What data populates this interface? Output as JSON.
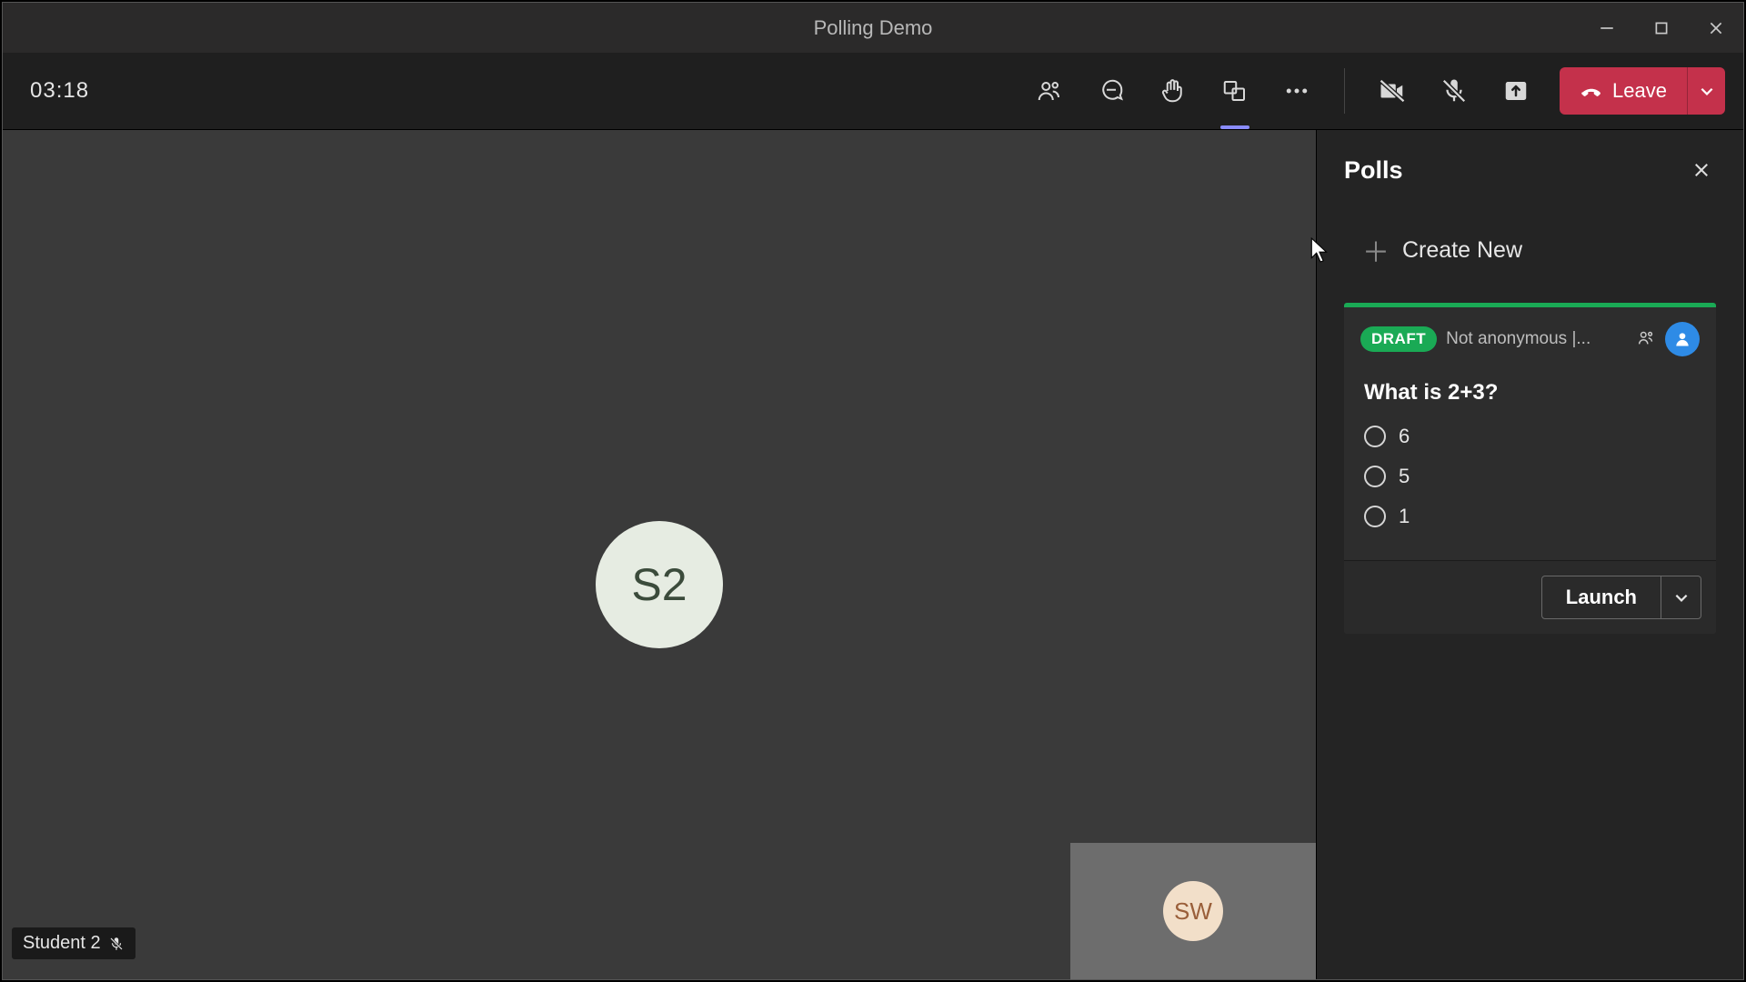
{
  "window": {
    "title": "Polling Demo"
  },
  "toolbar": {
    "timer": "03:18",
    "leave_label": "Leave"
  },
  "stage": {
    "main_participant_initials": "S2",
    "self_initials": "SW",
    "chip_name": "Student 2"
  },
  "panel": {
    "title": "Polls",
    "create_new_label": "Create New",
    "poll": {
      "status_badge": "DRAFT",
      "meta_text": "Not anonymous |...",
      "question": "What is 2+3?",
      "options": [
        "6",
        "5",
        "1"
      ],
      "launch_label": "Launch"
    }
  },
  "colors": {
    "accent_green": "#1aaa55",
    "leave_red": "#c4314b",
    "author_blue": "#2e8be6"
  }
}
